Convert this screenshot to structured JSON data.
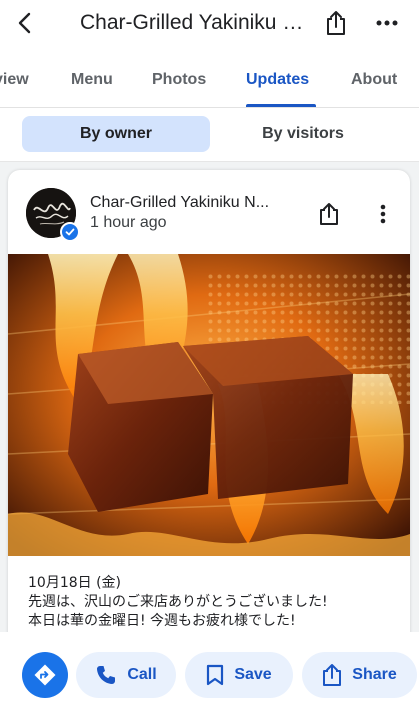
{
  "header": {
    "title": "Char-Grilled Yakiniku N...",
    "back_icon": "arrow-back-icon",
    "share_icon": "share-icon",
    "more_icon": "more-vert-icon"
  },
  "tabs": [
    {
      "label": "view"
    },
    {
      "label": "Menu"
    },
    {
      "label": "Photos"
    },
    {
      "label": "Updates",
      "active": true
    },
    {
      "label": "About"
    }
  ],
  "filters": {
    "by_owner": "By owner",
    "by_visitors": "By visitors",
    "selected": "By owner"
  },
  "post": {
    "owner_name": "Char-Grilled Yakiniku N...",
    "time": "1 hour ago",
    "verified": true,
    "photo_subject": "grilled meat over flames",
    "text_lines": [
      "10月18日 (金)",
      "先週は、沢山のご来店ありがとうございました!",
      "本日は華の金曜日! 今週もお疲れ様でした!"
    ]
  },
  "actions": {
    "directions_icon": "directions-icon",
    "call": "Call",
    "save": "Save",
    "share": "Share"
  },
  "colors": {
    "accent": "#1a56c4",
    "pill_bg": "#e9f1fd",
    "segment_selected_bg": "#d3e3fd",
    "fab": "#1a73e8"
  }
}
